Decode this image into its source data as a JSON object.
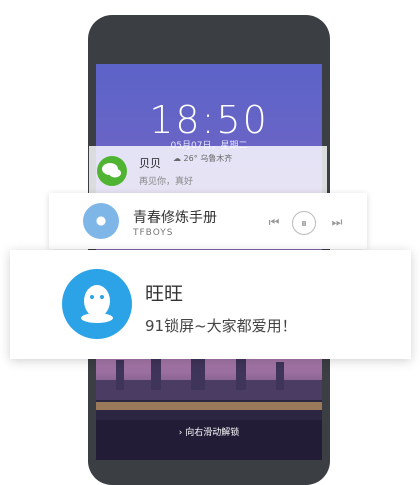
{
  "lockscreen": {
    "time": "18:50",
    "date": "05月07日，星期二",
    "unlock_hint": "向右滑动解锁"
  },
  "notifications": [
    {
      "app": "wechat",
      "title": "贝贝",
      "message": "再见你，真好",
      "weather": "26° 乌鲁木齐"
    },
    {
      "app": "music",
      "title": "青春修炼手册",
      "artist": "TFBOYS"
    },
    {
      "app": "qq",
      "title": "旺旺",
      "message": "91锁屏~大家都爱用！"
    }
  ],
  "colors": {
    "wechat": "#50b433",
    "qq": "#2ca3e6",
    "phone_bezel": "#3b3e43"
  },
  "icons": {
    "wechat": "wechat-icon",
    "album": "album-art-icon",
    "prev": "previous-icon",
    "pause": "pause-icon",
    "next": "next-icon",
    "qq": "qq-icon"
  }
}
